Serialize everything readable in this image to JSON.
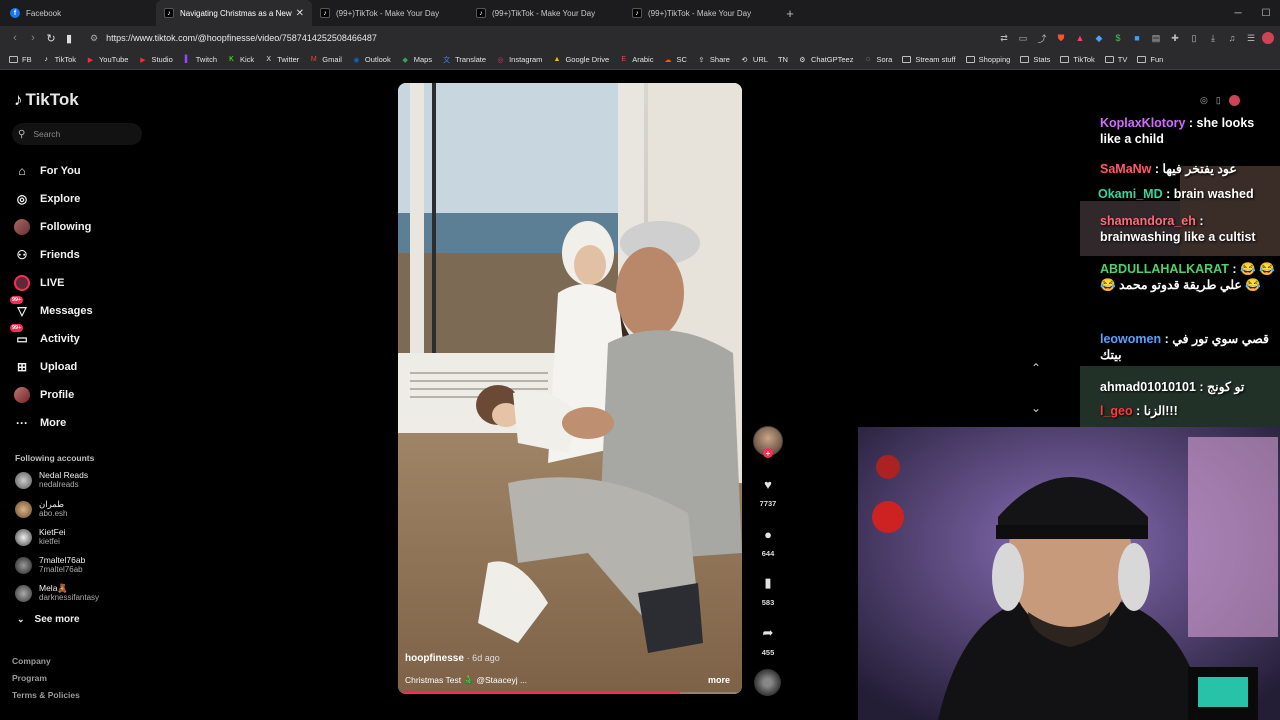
{
  "browser": {
    "tabs": [
      {
        "title": "Facebook",
        "icon": "facebook-icon",
        "active": false
      },
      {
        "title": "Navigating Christmas as a New M",
        "icon": "tiktok-icon",
        "active": true
      },
      {
        "title": "(99+)TikTok - Make Your Day",
        "icon": "tiktok-icon",
        "active": false
      },
      {
        "title": "(99+)TikTok - Make Your Day",
        "icon": "tiktok-icon",
        "active": false
      },
      {
        "title": "(99+)TikTok - Make Your Day",
        "icon": "tiktok-icon",
        "active": false
      }
    ],
    "new_tab": "+",
    "url": "https://www.tiktok.com/@hoopfinesse/video/7587414252508466487",
    "bookmarks": [
      {
        "label": "FB",
        "icon": "folder-icon"
      },
      {
        "label": "TikTok",
        "icon": "tiktok-icon"
      },
      {
        "label": "YouTube",
        "icon": "youtube-icon"
      },
      {
        "label": "Studio",
        "icon": "youtube-icon"
      },
      {
        "label": "Twitch",
        "icon": "twitch-icon"
      },
      {
        "label": "Kick",
        "icon": "kick-icon"
      },
      {
        "label": "Twitter",
        "icon": "x-icon"
      },
      {
        "label": "Gmail",
        "icon": "gmail-icon"
      },
      {
        "label": "Outlook",
        "icon": "outlook-icon"
      },
      {
        "label": "Maps",
        "icon": "maps-icon"
      },
      {
        "label": "Translate",
        "icon": "translate-icon"
      },
      {
        "label": "Instagram",
        "icon": "instagram-icon"
      },
      {
        "label": "Google Drive",
        "icon": "drive-icon"
      },
      {
        "label": "Arabic",
        "icon": "letter-icon"
      },
      {
        "label": "SC",
        "icon": "soundcloud-icon"
      },
      {
        "label": "Share",
        "icon": "share-icon"
      },
      {
        "label": "URL",
        "icon": "url-icon"
      },
      {
        "label": "TN",
        "icon": "none"
      },
      {
        "label": "ChatGPTeez",
        "icon": "chatgpt-icon"
      },
      {
        "label": "Sora",
        "icon": "sora-icon"
      },
      {
        "label": "Stream stuff",
        "icon": "folder-icon"
      },
      {
        "label": "Shopping",
        "icon": "folder-icon"
      },
      {
        "label": "Stats",
        "icon": "folder-icon"
      },
      {
        "label": "TikTok",
        "icon": "folder-icon"
      },
      {
        "label": "TV",
        "icon": "folder-icon"
      },
      {
        "label": "Fun",
        "icon": "folder-icon"
      }
    ]
  },
  "tiktok": {
    "logo": "TikTok",
    "search_placeholder": "Search",
    "nav": [
      {
        "label": "For You",
        "icon": "home-icon"
      },
      {
        "label": "Explore",
        "icon": "compass-icon"
      },
      {
        "label": "Following",
        "icon": "avatar-icon"
      },
      {
        "label": "Friends",
        "icon": "friends-icon"
      },
      {
        "label": "LIVE",
        "icon": "live-icon"
      },
      {
        "label": "Messages",
        "icon": "messages-icon",
        "badge": "99+"
      },
      {
        "label": "Activity",
        "icon": "activity-icon",
        "badge": "99+"
      },
      {
        "label": "Upload",
        "icon": "upload-icon"
      },
      {
        "label": "Profile",
        "icon": "profile-icon"
      },
      {
        "label": "More",
        "icon": "more-icon"
      }
    ],
    "following_header": "Following accounts",
    "following": [
      {
        "name": "Nedal Reads",
        "handle": "nedalreads"
      },
      {
        "name": "طمران",
        "handle": "abo.esh"
      },
      {
        "name": "KietFei",
        "handle": "kietfei"
      },
      {
        "name": "7maltel76ab",
        "handle": "7maltel76ab"
      },
      {
        "name": "Mela🧸",
        "handle": "darknessifantasy"
      }
    ],
    "see_more": "See more",
    "footer": [
      "Company",
      "Program",
      "Terms & Policies"
    ],
    "video": {
      "author": "hoopfinesse",
      "ago": "· 6d ago",
      "caption": "Christmas Test 🎄 @Staaceyj ...",
      "more": "more",
      "progress": 0.82
    },
    "actions": {
      "likes": "7737",
      "comments": "644",
      "saves": "583",
      "shares": "455"
    }
  },
  "stream_chat": [
    {
      "user": "KoplaxKlotory",
      "text": ": she looks like a child",
      "color": "#d46bff"
    },
    {
      "user": "SaMaNw",
      "text": ": عود يفتخر فيها",
      "color": "#ff5a6b"
    },
    {
      "user": "Okami_MD",
      "text": ": brain washed",
      "color": "#38d4a0"
    },
    {
      "user": "shamandora_eh",
      "text": ": brainwashing like a cultist",
      "color": "#ff6b7a"
    },
    {
      "user": "ABDULLAHALKARAT",
      "text": ": 😂 😂 😂 علي طريقة قدوتو محمد 😂",
      "color": "#4fd16b"
    },
    {
      "user": "leowomen",
      "text": ": قصي سوي تور في بيتك",
      "color": "#5aa0ff"
    },
    {
      "user": "ahmad01010101",
      "text": ": تو كونج",
      "color": "#ffffff"
    },
    {
      "user": "l_geo",
      "text": ": الزنا!!!",
      "color": "#ff3b3b"
    }
  ]
}
